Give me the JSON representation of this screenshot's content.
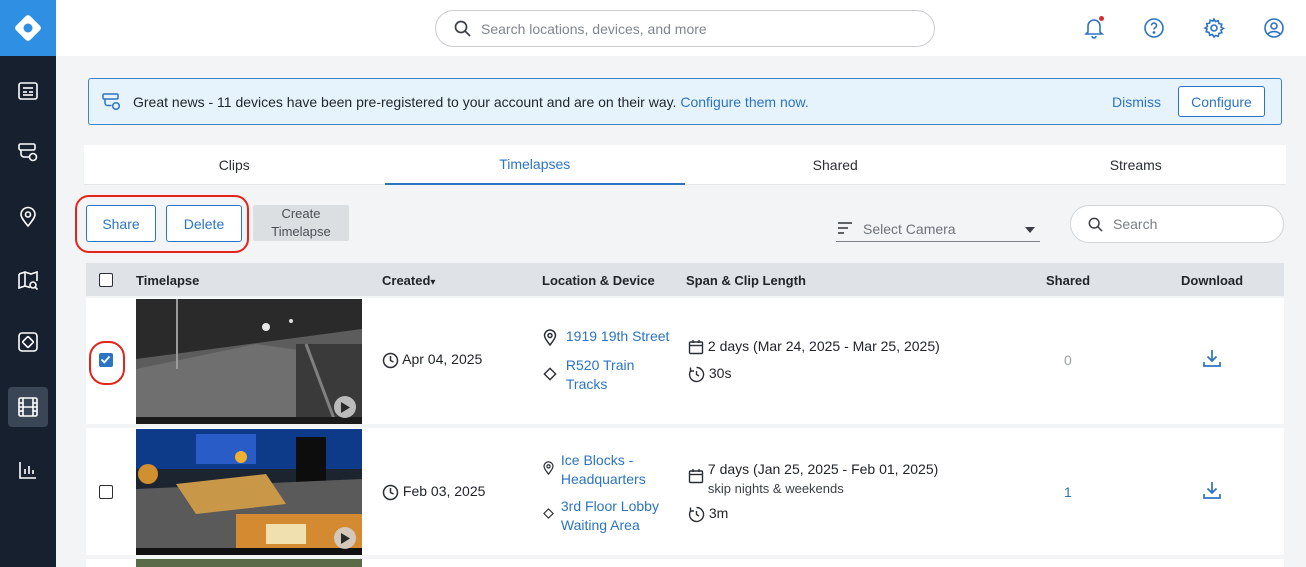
{
  "header": {
    "search_placeholder": "Search locations, devices, and more"
  },
  "banner": {
    "message": "Great news - 11 devices have been pre-registered to your account and are on their way.",
    "link": "Configure them now.",
    "dismiss_label": "Dismiss",
    "configure_label": "Configure"
  },
  "tabs": [
    {
      "label": "Clips"
    },
    {
      "label": "Timelapses"
    },
    {
      "label": "Shared"
    },
    {
      "label": "Streams"
    }
  ],
  "active_tab": "Timelapses",
  "toolbar": {
    "share_label": "Share",
    "delete_label": "Delete",
    "create_line1": "Create",
    "create_line2": "Timelapse",
    "camera_placeholder": "Select Camera",
    "search_placeholder": "Search"
  },
  "table": {
    "headers": {
      "timelapse": "Timelapse",
      "created": "Created",
      "sort_arrow": "▾",
      "location": "Location & Device",
      "span": "Span & Clip Length",
      "shared": "Shared",
      "download": "Download"
    },
    "rows": [
      {
        "checked": true,
        "created": "Apr 04, 2025",
        "location": "1919 19th Street",
        "device_line1": "R520 Train",
        "device_line2": "Tracks",
        "span": "2 days (Mar 24, 2025 - Mar 25, 2025)",
        "span_note": "",
        "clip_length": "30s",
        "shared": "0"
      },
      {
        "checked": false,
        "created": "Feb 03, 2025",
        "location_line1": "Ice Blocks -",
        "location_line2": "Headquarters",
        "device_line1": "3rd Floor Lobby",
        "device_line2": "Waiting Area",
        "span": "7 days (Jan 25, 2025 - Feb 01, 2025)",
        "span_note": "skip nights & weekends",
        "clip_length": "3m",
        "shared": "1"
      }
    ]
  },
  "colors": {
    "accent": "#2c74c2",
    "sidebar": "#16202e",
    "highlight": "#e1251b"
  }
}
